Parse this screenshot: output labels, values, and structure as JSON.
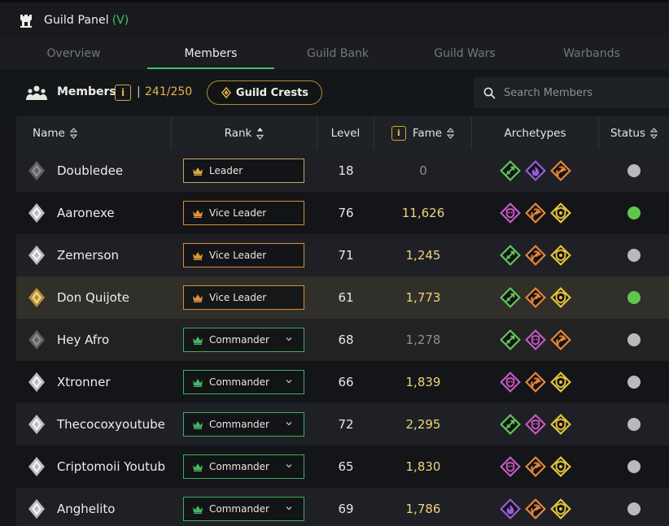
{
  "header": {
    "title": "Guild Panel",
    "shortcut": "(V)"
  },
  "tabs": [
    {
      "label": "Overview",
      "active": false
    },
    {
      "label": "Members",
      "active": true
    },
    {
      "label": "Guild Bank",
      "active": false
    },
    {
      "label": "Guild Wars",
      "active": false
    },
    {
      "label": "Warbands",
      "active": false
    }
  ],
  "toolbar": {
    "members_label": "Members",
    "info_glyph": "i",
    "separator": "|",
    "member_count": "241/250",
    "crests_button": "Guild Crests",
    "search_placeholder": "Search Members",
    "icons": [
      "castle-icon",
      "members-icon",
      "crest-icon",
      "search-icon"
    ]
  },
  "table": {
    "columns": {
      "name": "Name",
      "rank": "Rank",
      "level": "Level",
      "fame_info": "i",
      "fame": "Fame",
      "archetypes": "Archetypes",
      "status": "Status"
    },
    "rows": [
      {
        "name": "Doubledee",
        "rank": "Leader",
        "rank_style": "gold",
        "level": "18",
        "fame": "0",
        "fame_muted": true,
        "archetypes": [
          "green-dagger",
          "purple-flame",
          "orange-axe"
        ],
        "online": false,
        "emblem": "grey",
        "row_style": "alt"
      },
      {
        "name": "Aaronexe",
        "rank": "Vice Leader",
        "rank_style": "orange",
        "level": "76",
        "fame": "11,626",
        "fame_muted": false,
        "archetypes": [
          "pink-mask",
          "orange-axe",
          "yellow-shield"
        ],
        "online": true,
        "emblem": "silver",
        "row_style": "base"
      },
      {
        "name": "Zemerson",
        "rank": "Vice Leader",
        "rank_style": "orange",
        "level": "71",
        "fame": "1,245",
        "fame_muted": false,
        "archetypes": [
          "green-dagger",
          "orange-axe",
          "yellow-shield"
        ],
        "online": false,
        "emblem": "silver",
        "row_style": "alt"
      },
      {
        "name": "Don Quijote",
        "rank": "Vice Leader",
        "rank_style": "orange",
        "level": "61",
        "fame": "1,773",
        "fame_muted": false,
        "archetypes": [
          "green-dagger",
          "orange-axe",
          "yellow-shield"
        ],
        "online": true,
        "emblem": "gold",
        "row_style": "hl"
      },
      {
        "name": "Hey Afro",
        "rank": "Commander",
        "rank_style": "green",
        "level": "68",
        "fame": "1,278",
        "fame_muted": true,
        "archetypes": [
          "green-dagger",
          "pink-mask",
          "orange-axe"
        ],
        "online": false,
        "emblem": "grey",
        "row_style": "dim"
      },
      {
        "name": "Xtronner",
        "rank": "Commander",
        "rank_style": "green",
        "level": "66",
        "fame": "1,839",
        "fame_muted": false,
        "archetypes": [
          "pink-mask",
          "orange-axe",
          "yellow-shield"
        ],
        "online": false,
        "emblem": "silver",
        "row_style": "base"
      },
      {
        "name": "Thecocoxyoutube",
        "rank": "Commander",
        "rank_style": "green",
        "level": "72",
        "fame": "2,295",
        "fame_muted": false,
        "archetypes": [
          "green-dagger",
          "pink-mask",
          "yellow-shield"
        ],
        "online": false,
        "emblem": "silver",
        "row_style": "alt"
      },
      {
        "name": "Criptomoii Youtub",
        "rank": "Commander",
        "rank_style": "green",
        "level": "65",
        "fame": "1,830",
        "fame_muted": false,
        "archetypes": [
          "pink-mask",
          "orange-axe",
          "yellow-shield"
        ],
        "online": false,
        "emblem": "silver",
        "row_style": "base"
      },
      {
        "name": "Anghelito",
        "rank": "Commander",
        "rank_style": "green",
        "level": "69",
        "fame": "1,786",
        "fame_muted": false,
        "archetypes": [
          "purple-flame",
          "orange-axe",
          "yellow-shield"
        ],
        "online": false,
        "emblem": "silver",
        "row_style": "alt"
      }
    ]
  },
  "colors": {
    "accent_green": "#3fbf75",
    "gold": "#e3b44c",
    "fame": "#f1d27c",
    "online": "#5ec64c",
    "offline": "#b8babd",
    "archetype_green": "#5fc85a",
    "archetype_purple": "#9a5cd9",
    "archetype_orange": "#e8853a",
    "archetype_yellow": "#e7c43d",
    "archetype_pink": "#c85ac4"
  }
}
